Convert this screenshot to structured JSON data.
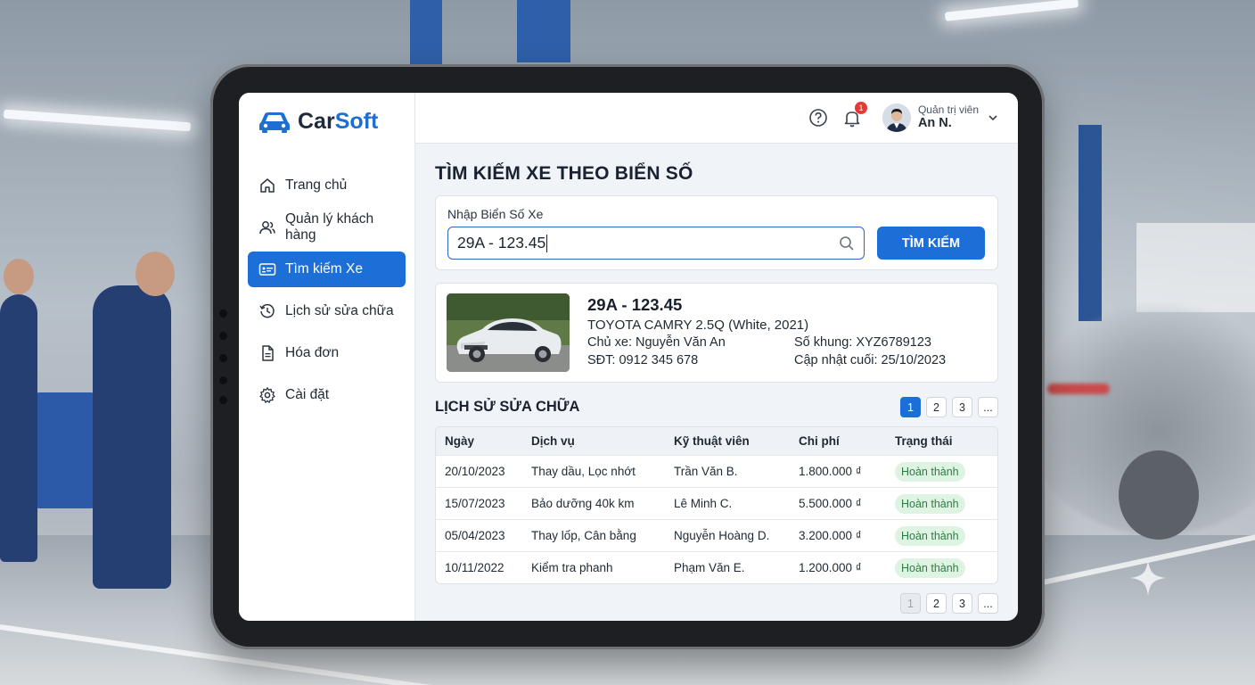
{
  "app": {
    "brand_part1": "Car",
    "brand_part2": "Soft",
    "accent_color": "#1c6fd6"
  },
  "sidebar": {
    "items": [
      {
        "label": "Trang chủ",
        "icon": "home-icon",
        "active": false
      },
      {
        "label": "Quản lý khách hàng",
        "icon": "users-icon",
        "active": false
      },
      {
        "label": "Tìm kiếm Xe",
        "icon": "id-card-icon",
        "active": true
      },
      {
        "label": "Lịch sử sửa chữa",
        "icon": "history-icon",
        "active": false
      },
      {
        "label": "Hóa đơn",
        "icon": "invoice-icon",
        "active": false
      },
      {
        "label": "Cài đặt",
        "icon": "gear-icon",
        "active": false
      }
    ]
  },
  "topbar": {
    "notification_count": "1",
    "user_role": "Quản trị viên",
    "user_name": "An N."
  },
  "search": {
    "title": "TÌM KIẾM XE THEO BIỂN SỐ",
    "label": "Nhập Biển Số Xe",
    "value": "29A - 123.45",
    "button": "TÌM KIẾM"
  },
  "vehicle": {
    "plate": "29A - 123.45",
    "model": "TOYOTA CAMRY 2.5Q (White, 2021)",
    "owner": "Chủ xe: Nguyễn Văn An",
    "phone": "SĐT: 0912 345 678",
    "chassis": "Số khung: XYZ6789123",
    "updated": "Cập nhật cuối: 25/10/2023"
  },
  "history": {
    "title": "LỊCH SỬ SỬA CHỮA",
    "columns": [
      "Ngày",
      "Dịch vụ",
      "Kỹ thuật viên",
      "Chi phí",
      "Trạng thái"
    ],
    "rows": [
      {
        "date": "20/10/2023",
        "service": "Thay dầu, Lọc nhớt",
        "tech": "Trần Văn B.",
        "cost": "1.800.000 ₫",
        "status": "Hoàn thành"
      },
      {
        "date": "15/07/2023",
        "service": "Bảo dưỡng 40k km",
        "tech": "Lê Minh C.",
        "cost": "5.500.000 ₫",
        "status": "Hoàn thành"
      },
      {
        "date": "05/04/2023",
        "service": "Thay lốp, Cân bằng",
        "tech": "Nguyễn Hoàng D.",
        "cost": "3.200.000 ₫",
        "status": "Hoàn thành"
      },
      {
        "date": "10/11/2022",
        "service": "Kiểm tra phanh",
        "tech": "Phạm Văn E.",
        "cost": "1.200.000 ₫",
        "status": "Hoàn thành"
      }
    ],
    "pager_top": [
      "1",
      "2",
      "3",
      "..."
    ],
    "pager_bottom": [
      "1",
      "2",
      "3",
      "..."
    ]
  }
}
